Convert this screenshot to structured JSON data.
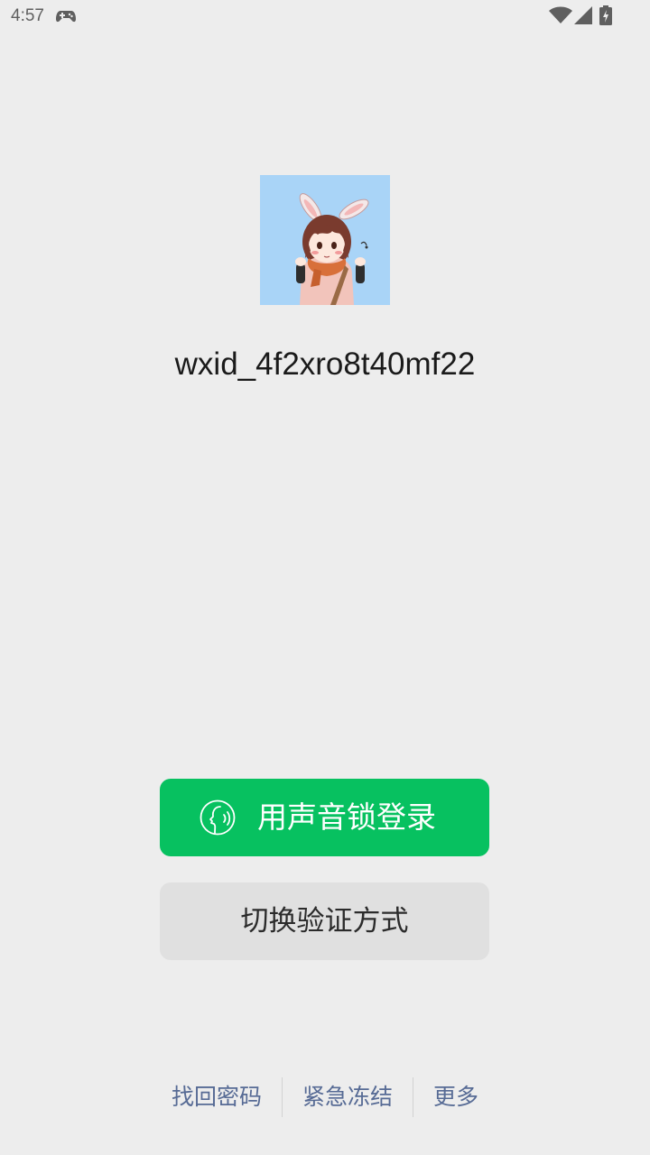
{
  "status_bar": {
    "time": "4:57",
    "icons": [
      "gamepad-icon",
      "wifi-icon",
      "signal-icon",
      "battery-charging-icon"
    ]
  },
  "account": {
    "avatar": "anime-girl-bunny-ears-avatar",
    "username": "wxid_4f2xro8t40mf22"
  },
  "actions": {
    "voice_login_label": "用声音锁登录",
    "voice_icon": "voice-lock-icon",
    "switch_verify_label": "切换验证方式"
  },
  "footer": {
    "links": [
      "找回密码",
      "紧急冻结",
      "更多"
    ]
  },
  "colors": {
    "primary_green": "#07c160",
    "link_blue": "#576b95",
    "background": "#ededed",
    "secondary_button": "#e0e0e0"
  }
}
